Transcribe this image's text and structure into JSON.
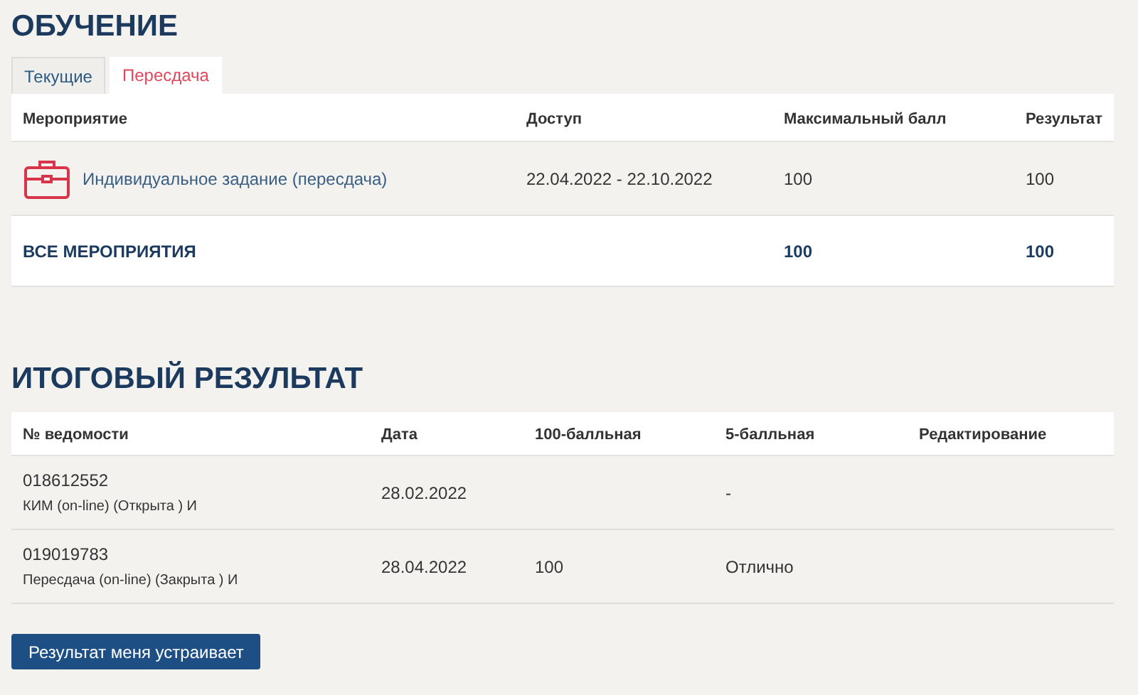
{
  "learning": {
    "title": "ОБУЧЕНИЕ",
    "tabs": [
      {
        "label": "Текущие",
        "selected": false
      },
      {
        "label": "Пересдача",
        "selected": true
      }
    ],
    "table": {
      "columns": [
        "Мероприятие",
        "Доступ",
        "Максимальный балл",
        "Результат"
      ],
      "rows": [
        {
          "event": "Индивидуальное задание (пересдача)",
          "access": "22.04.2022 - 22.10.2022",
          "max_score": "100",
          "result": "100"
        }
      ],
      "total": {
        "label": "ВСЕ МЕРОПРИЯТИЯ",
        "max_score": "100",
        "result": "100"
      }
    }
  },
  "final": {
    "title": "ИТОГОВЫЙ РЕЗУЛЬТАТ",
    "table": {
      "columns": [
        "№ ведомости",
        "Дата",
        "100-балльная",
        "5-балльная",
        "Редактирование"
      ],
      "rows": [
        {
          "number": "018612552",
          "description": "КИМ (on-line) (Открыта ) И",
          "date": "28.02.2022",
          "score_100": "",
          "score_5": "-"
        },
        {
          "number": "019019783",
          "description": "Пересдача (on-line) (Закрыта ) И",
          "date": "28.04.2022",
          "score_100": "100",
          "score_5": "Отлично"
        }
      ]
    },
    "button": "Результат меня устраивает"
  }
}
